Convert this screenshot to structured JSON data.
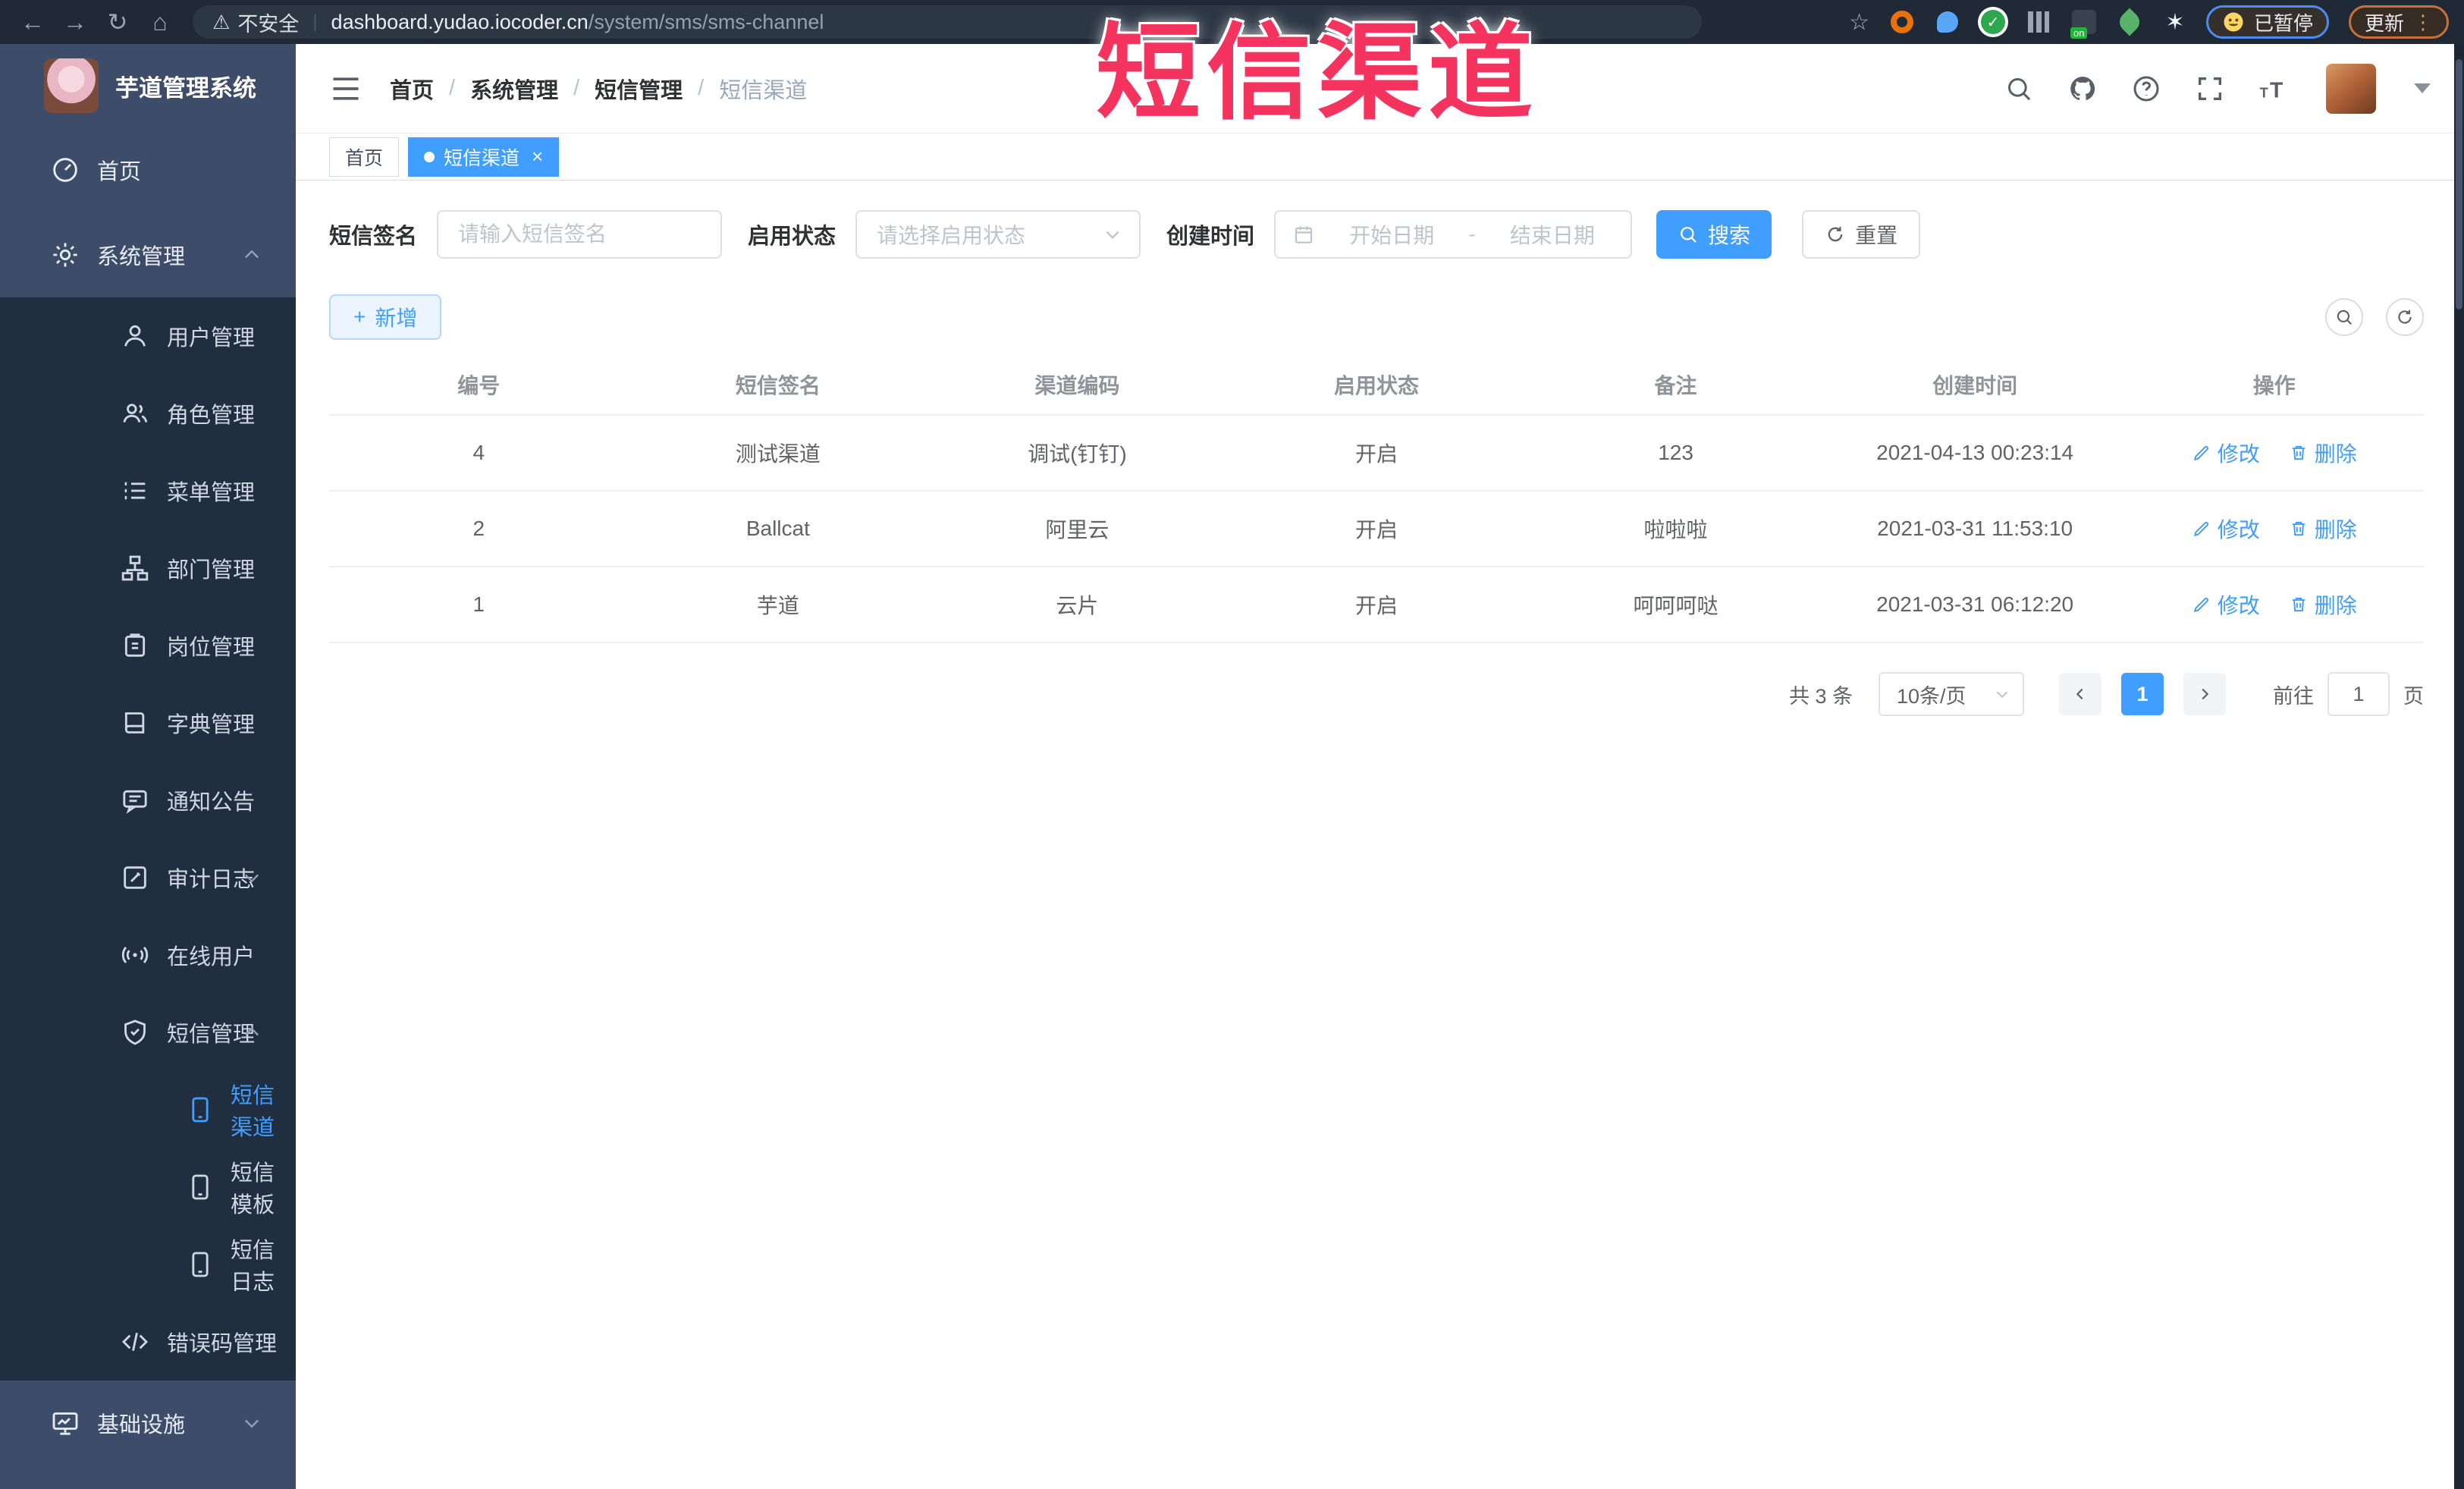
{
  "annotation": {
    "text": "短信渠道"
  },
  "browser": {
    "security_label": "不安全",
    "url_host": "dashboard.yudao.iocoder.cn",
    "url_path": "/system/sms/sms-channel",
    "paused_chip": "已暂停",
    "update_chip": "更新"
  },
  "sidebar": {
    "logo_title": "芋道管理系统",
    "items": [
      {
        "label": "首页",
        "icon": "dashboard-icon"
      },
      {
        "label": "系统管理",
        "icon": "gear-icon",
        "state": "expanded"
      },
      {
        "label": "用户管理",
        "icon": "user-icon"
      },
      {
        "label": "角色管理",
        "icon": "users-icon"
      },
      {
        "label": "菜单管理",
        "icon": "menu-list-icon"
      },
      {
        "label": "部门管理",
        "icon": "org-tree-icon"
      },
      {
        "label": "岗位管理",
        "icon": "badge-icon"
      },
      {
        "label": "字典管理",
        "icon": "book-icon"
      },
      {
        "label": "通知公告",
        "icon": "announcement-icon"
      },
      {
        "label": "审计日志",
        "icon": "audit-log-icon",
        "state": "collapsed"
      },
      {
        "label": "在线用户",
        "icon": "online-users-icon"
      },
      {
        "label": "短信管理",
        "icon": "sms-shield-icon",
        "state": "expanded"
      },
      {
        "label": "短信渠道",
        "icon": "phone-icon",
        "active": true
      },
      {
        "label": "短信模板",
        "icon": "phone-icon"
      },
      {
        "label": "短信日志",
        "icon": "phone-icon"
      },
      {
        "label": "错误码管理",
        "icon": "code-icon"
      },
      {
        "label": "基础设施",
        "icon": "monitor-icon",
        "state": "collapsed"
      }
    ]
  },
  "header": {
    "breadcrumb": [
      "首页",
      "系统管理",
      "短信管理",
      "短信渠道"
    ],
    "separator": "/"
  },
  "tabs": [
    {
      "label": "首页"
    },
    {
      "label": "短信渠道",
      "active": true
    }
  ],
  "filters": {
    "signature_label": "短信签名",
    "signature_placeholder": "请输入短信签名",
    "status_label": "启用状态",
    "status_placeholder": "请选择启用状态",
    "date_label": "创建时间",
    "date_start_placeholder": "开始日期",
    "date_separator": "-",
    "date_end_placeholder": "结束日期",
    "search_label": "搜索",
    "reset_label": "重置"
  },
  "toolbar": {
    "add_label": "新增"
  },
  "table": {
    "headers": [
      "编号",
      "短信签名",
      "渠道编码",
      "启用状态",
      "备注",
      "创建时间",
      "操作"
    ],
    "edit_label": "修改",
    "delete_label": "删除",
    "rows": [
      {
        "id": "4",
        "signature": "测试渠道",
        "code": "调试(钉钉)",
        "status": "开启",
        "remark": "123",
        "created": "2021-04-13 00:23:14"
      },
      {
        "id": "2",
        "signature": "Ballcat",
        "code": "阿里云",
        "status": "开启",
        "remark": "啦啦啦",
        "created": "2021-03-31 11:53:10"
      },
      {
        "id": "1",
        "signature": "芋道",
        "code": "云片",
        "status": "开启",
        "remark": "呵呵呵哒",
        "created": "2021-03-31 06:12:20"
      }
    ]
  },
  "pagination": {
    "total": "共 3 条",
    "page_size": "10条/页",
    "current_page": "1",
    "goto_label": "前往",
    "goto_value": "1",
    "page_unit": "页"
  },
  "colors": {
    "accent": "#409eff",
    "annotation": "#f5335f",
    "sidebar_dark": "#212e40",
    "sidebar_light": "#3d4c68"
  }
}
